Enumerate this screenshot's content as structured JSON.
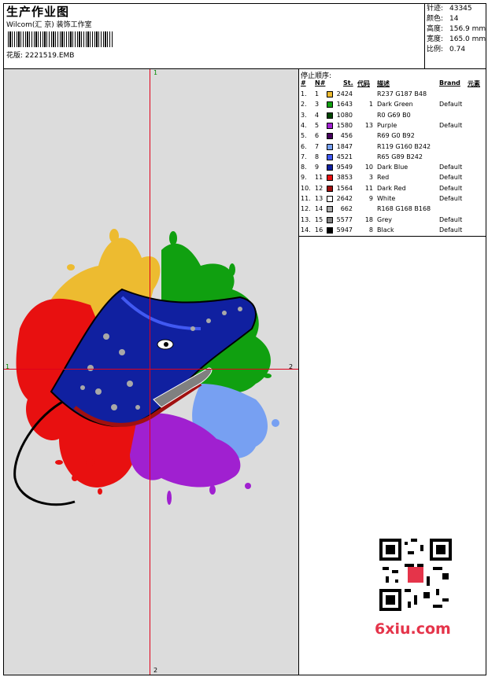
{
  "header": {
    "title": "生产作业图",
    "company": "Wilcom(汇 京) 装饰工作室",
    "design_label": "花版: 2221519.EMB"
  },
  "stats": [
    {
      "label": "针迹:",
      "value": "43345"
    },
    {
      "label": "颜色:",
      "value": "14"
    },
    {
      "label": "高度:",
      "value": "156.9 mm"
    },
    {
      "label": "宽度:",
      "value": "165.0 mm"
    },
    {
      "label": "比例:",
      "value": "0.74"
    }
  ],
  "canvas": {
    "background": "#dcdcdc",
    "axis_color": "#e0001a",
    "axis_labels": {
      "top": "1",
      "bottom": "2",
      "left": "1",
      "right": "2"
    }
  },
  "stops": {
    "title": "停止顺序:",
    "headers": {
      "num": "#",
      "needle": "N#",
      "stitches": "St.",
      "code": "代码",
      "description": "描述",
      "brand": "Brand",
      "element": "元素"
    },
    "rows": [
      {
        "num": "1.",
        "needle": "1",
        "color": "#EDBB30",
        "stitches": "2424",
        "code": "",
        "description": "R237 G187 B48",
        "brand": ""
      },
      {
        "num": "2.",
        "needle": "3",
        "color": "#10A010",
        "stitches": "1643",
        "code": "1",
        "description": "Dark Green",
        "brand": "Default"
      },
      {
        "num": "3.",
        "needle": "4",
        "color": "#004500",
        "stitches": "1080",
        "code": "",
        "description": "R0 G69 B0",
        "brand": ""
      },
      {
        "num": "4.",
        "needle": "5",
        "color": "#A020D0",
        "stitches": "1580",
        "code": "13",
        "description": "Purple",
        "brand": "Default"
      },
      {
        "num": "5.",
        "needle": "6",
        "color": "#45005C",
        "stitches": "456",
        "code": "",
        "description": "R69 G0 B92",
        "brand": ""
      },
      {
        "num": "6.",
        "needle": "7",
        "color": "#77A0F2",
        "stitches": "1847",
        "code": "",
        "description": "R119 G160 B242",
        "brand": ""
      },
      {
        "num": "7.",
        "needle": "8",
        "color": "#4159F2",
        "stitches": "4521",
        "code": "",
        "description": "R65 G89 B242",
        "brand": ""
      },
      {
        "num": "8.",
        "needle": "9",
        "color": "#1020A0",
        "stitches": "9549",
        "code": "10",
        "description": "Dark Blue",
        "brand": "Default"
      },
      {
        "num": "9.",
        "needle": "11",
        "color": "#E81010",
        "stitches": "3853",
        "code": "3",
        "description": "Red",
        "brand": "Default"
      },
      {
        "num": "10.",
        "needle": "12",
        "color": "#A01010",
        "stitches": "1564",
        "code": "11",
        "description": "Dark Red",
        "brand": "Default"
      },
      {
        "num": "11.",
        "needle": "13",
        "color": "#FFFFFF",
        "stitches": "2642",
        "code": "9",
        "description": "White",
        "brand": "Default"
      },
      {
        "num": "12.",
        "needle": "14",
        "color": "#A8A8A8",
        "stitches": "662",
        "code": "",
        "description": "R168 G168 B168",
        "brand": ""
      },
      {
        "num": "13.",
        "needle": "15",
        "color": "#808080",
        "stitches": "5577",
        "code": "18",
        "description": "Grey",
        "brand": "Default"
      },
      {
        "num": "14.",
        "needle": "16",
        "color": "#000000",
        "stitches": "5947",
        "code": "8",
        "description": "Black",
        "brand": "Default"
      }
    ]
  },
  "watermark": "6xiu.com"
}
